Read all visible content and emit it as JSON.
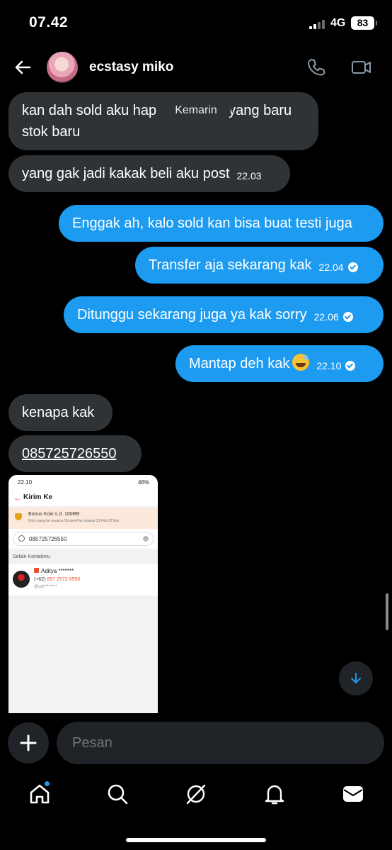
{
  "status_bar": {
    "time": "07.42",
    "network": "4G",
    "battery": "83"
  },
  "header": {
    "contact_name": "ecstasy miko"
  },
  "date_divider": "Kemarin",
  "messages": [
    {
      "dir": "in",
      "line1_a": "kan dah sold aku hap",
      "line1_b": "yang baru",
      "line2": "stok baru"
    },
    {
      "dir": "in",
      "text": "yang gak jadi kakak beli aku post",
      "time": "22.03"
    },
    {
      "dir": "out",
      "text": "Enggak ah, kalo sold kan bisa buat testi juga"
    },
    {
      "dir": "out",
      "text": "Transfer aja sekarang kak",
      "time": "22.04"
    },
    {
      "dir": "out",
      "text": "Ditunggu sekarang juga ya kak sorry",
      "time": "22.06"
    },
    {
      "dir": "out",
      "text": "Mantap deh kak",
      "time": "22.10",
      "emoji": "grinning-sweat"
    },
    {
      "dir": "in",
      "text": "kenapa kak"
    },
    {
      "dir": "in",
      "text": "085725726550"
    }
  ],
  "attachment": {
    "status_time": "22.10",
    "status_right": "46%",
    "title": "Kirim Ke",
    "promo_title": "Bonus Koin s.d. 100RB",
    "promo_sub": "Kirim uang ke sesama ShopeePay selama 13 Feb-22 Mar",
    "search_value": "085725726550",
    "section": "Selain Kontakmu",
    "contact_name": "Aditya *******",
    "contact_phone_prefix": "(+62)",
    "contact_phone": "857 2572 6550",
    "contact_handle": "@cal********"
  },
  "composer": {
    "placeholder": "Pesan"
  },
  "nav": [
    "home",
    "search",
    "grok",
    "notifications",
    "messages"
  ],
  "colors": {
    "accent": "#1d9bf0",
    "incoming_bubble": "#2f3336",
    "background": "#000000"
  }
}
